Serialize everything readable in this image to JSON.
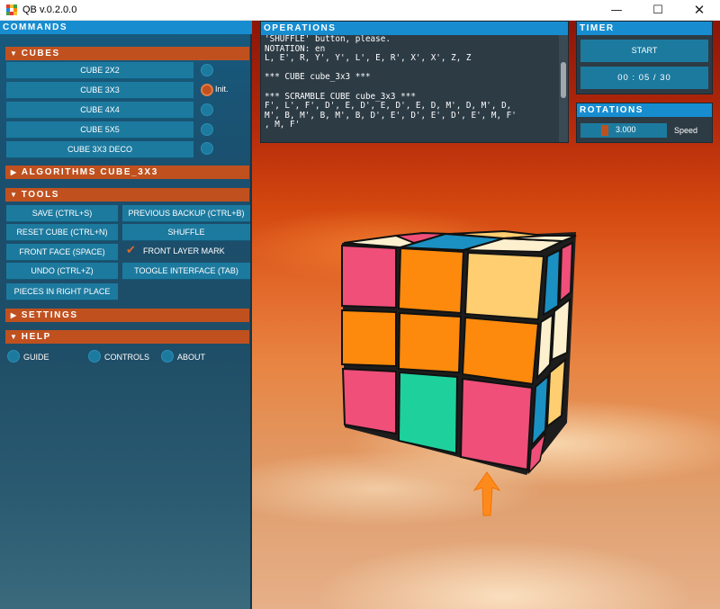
{
  "window": {
    "title": "QB v.0.2.0.0",
    "minimize_glyph": "—",
    "maximize_glyph": "☐",
    "close_glyph": "✕",
    "logo_colors": [
      "#e53935",
      "#fbc02d",
      "#43a047",
      "#1e88e5",
      "#ffffff",
      "#fb8c00",
      "#43a047",
      "#e53935",
      "#fbc02d"
    ]
  },
  "commands": {
    "header": "COMMANDS",
    "cubes": {
      "title": "CUBES",
      "arrow": "▼",
      "items": [
        {
          "label": "CUBE 2X2",
          "selected": false
        },
        {
          "label": "CUBE 3X3",
          "selected": true,
          "badge": "Init."
        },
        {
          "label": "CUBE 4X4",
          "selected": false
        },
        {
          "label": "CUBE 5X5",
          "selected": false
        },
        {
          "label": "CUBE 3X3 DECO",
          "selected": false
        }
      ]
    },
    "algorithms": {
      "title": "ALGORITHMS CUBE_3X3",
      "arrow": "▶"
    },
    "tools": {
      "title": "TOOLS",
      "arrow": "▼",
      "save": "SAVE (CTRL+S)",
      "previous_backup": "PREVIOUS BACKUP (CTRL+B)",
      "reset": "RESET CUBE (CTRL+N)",
      "shuffle": "SHUFFLE",
      "front_face": "FRONT FACE (SPACE)",
      "front_layer_mark": "FRONT LAYER MARK",
      "front_layer_checked": true,
      "check_glyph": "✔",
      "undo": "UNDO (CTRL+Z)",
      "toggle_interface": "TOOGLE INTERFACE (TAB)",
      "pieces": "PIECES IN RIGHT PLACE"
    },
    "settings": {
      "title": "SETTINGS",
      "arrow": "▶"
    },
    "help": {
      "title": "HELP",
      "arrow": "▼",
      "guide": "GUIDE",
      "controls": "CONTROLS",
      "about": "ABOUT"
    }
  },
  "operations": {
    "header": "OPERATIONS",
    "log": "'SHUFFLE' button, please.\nNOTATION: en\nL, E', R, Y', Y', L', E, R', X', X', Z, Z\n\n*** CUBE cube_3x3 ***\n\n*** SCRAMBLE CUBE cube_3x3 ***\nF', L', F', D', E, D', E, D', E, D, M', D, M', D,\nM', B, M', B, M', B, D', E', D', E', D', E', M, F'\n, M, F'"
  },
  "timer": {
    "header": "TIMER",
    "start": "START",
    "display": "00 : 05 / 30"
  },
  "rotations": {
    "header": "ROTATIONS",
    "speed_value": "3.000",
    "speed_label": "Speed"
  },
  "colors": {
    "pink": "#ef4f79",
    "orange": "#fd8a0c",
    "peach": "#fece70",
    "green": "#1ed19c",
    "blue": "#1b90c2",
    "cream": "#fdf0cf",
    "accent": "#c0511f",
    "button": "#1c7a9f"
  }
}
